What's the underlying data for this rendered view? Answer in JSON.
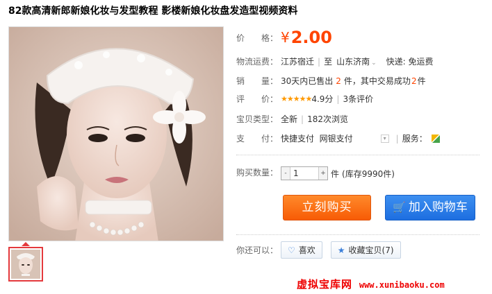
{
  "product": {
    "title": "82款高清新郎新娘化妆与发型教程 影楼新娘化妆盘发造型视频资料"
  },
  "price": {
    "label": "价　　格：",
    "currency": "¥",
    "value": "2.00"
  },
  "shipping": {
    "label": "物流运费：",
    "from": "江苏宿迁",
    "to_prefix": "至",
    "to": "山东济南",
    "fee": "快递: 免运费"
  },
  "sales": {
    "label": "销　　量：",
    "text1": "30天内已售出",
    "sold": "2",
    "text2": "件，其中交易成功",
    "success": "2",
    "text3": "件"
  },
  "rating": {
    "label": "评　　价：",
    "stars": "★★★★★",
    "score": "4.9分",
    "reviews": "3条评价"
  },
  "type": {
    "label": "宝贝类型：",
    "condition": "全新",
    "views": "182次浏览"
  },
  "payment": {
    "label": "支　　付：",
    "options": "快捷支付  网银支付",
    "service_label": "服务："
  },
  "quantity": {
    "label": "购买数量：",
    "minus": "-",
    "value": "1",
    "plus": "+",
    "unit": "件",
    "stock": "(库存9990件)"
  },
  "actions": {
    "buy_label": "立刻购买",
    "cart_label": "加入购物车"
  },
  "share": {
    "label": "你还可以：",
    "like_label": "喜欢",
    "collect_label": "收藏宝贝(7)"
  },
  "watermark": {
    "cn": "虚拟宝库网",
    "url": "www.xunibaoku.com"
  },
  "colors": {
    "accent_orange": "#ff5500",
    "accent_blue": "#1d6ee0"
  }
}
